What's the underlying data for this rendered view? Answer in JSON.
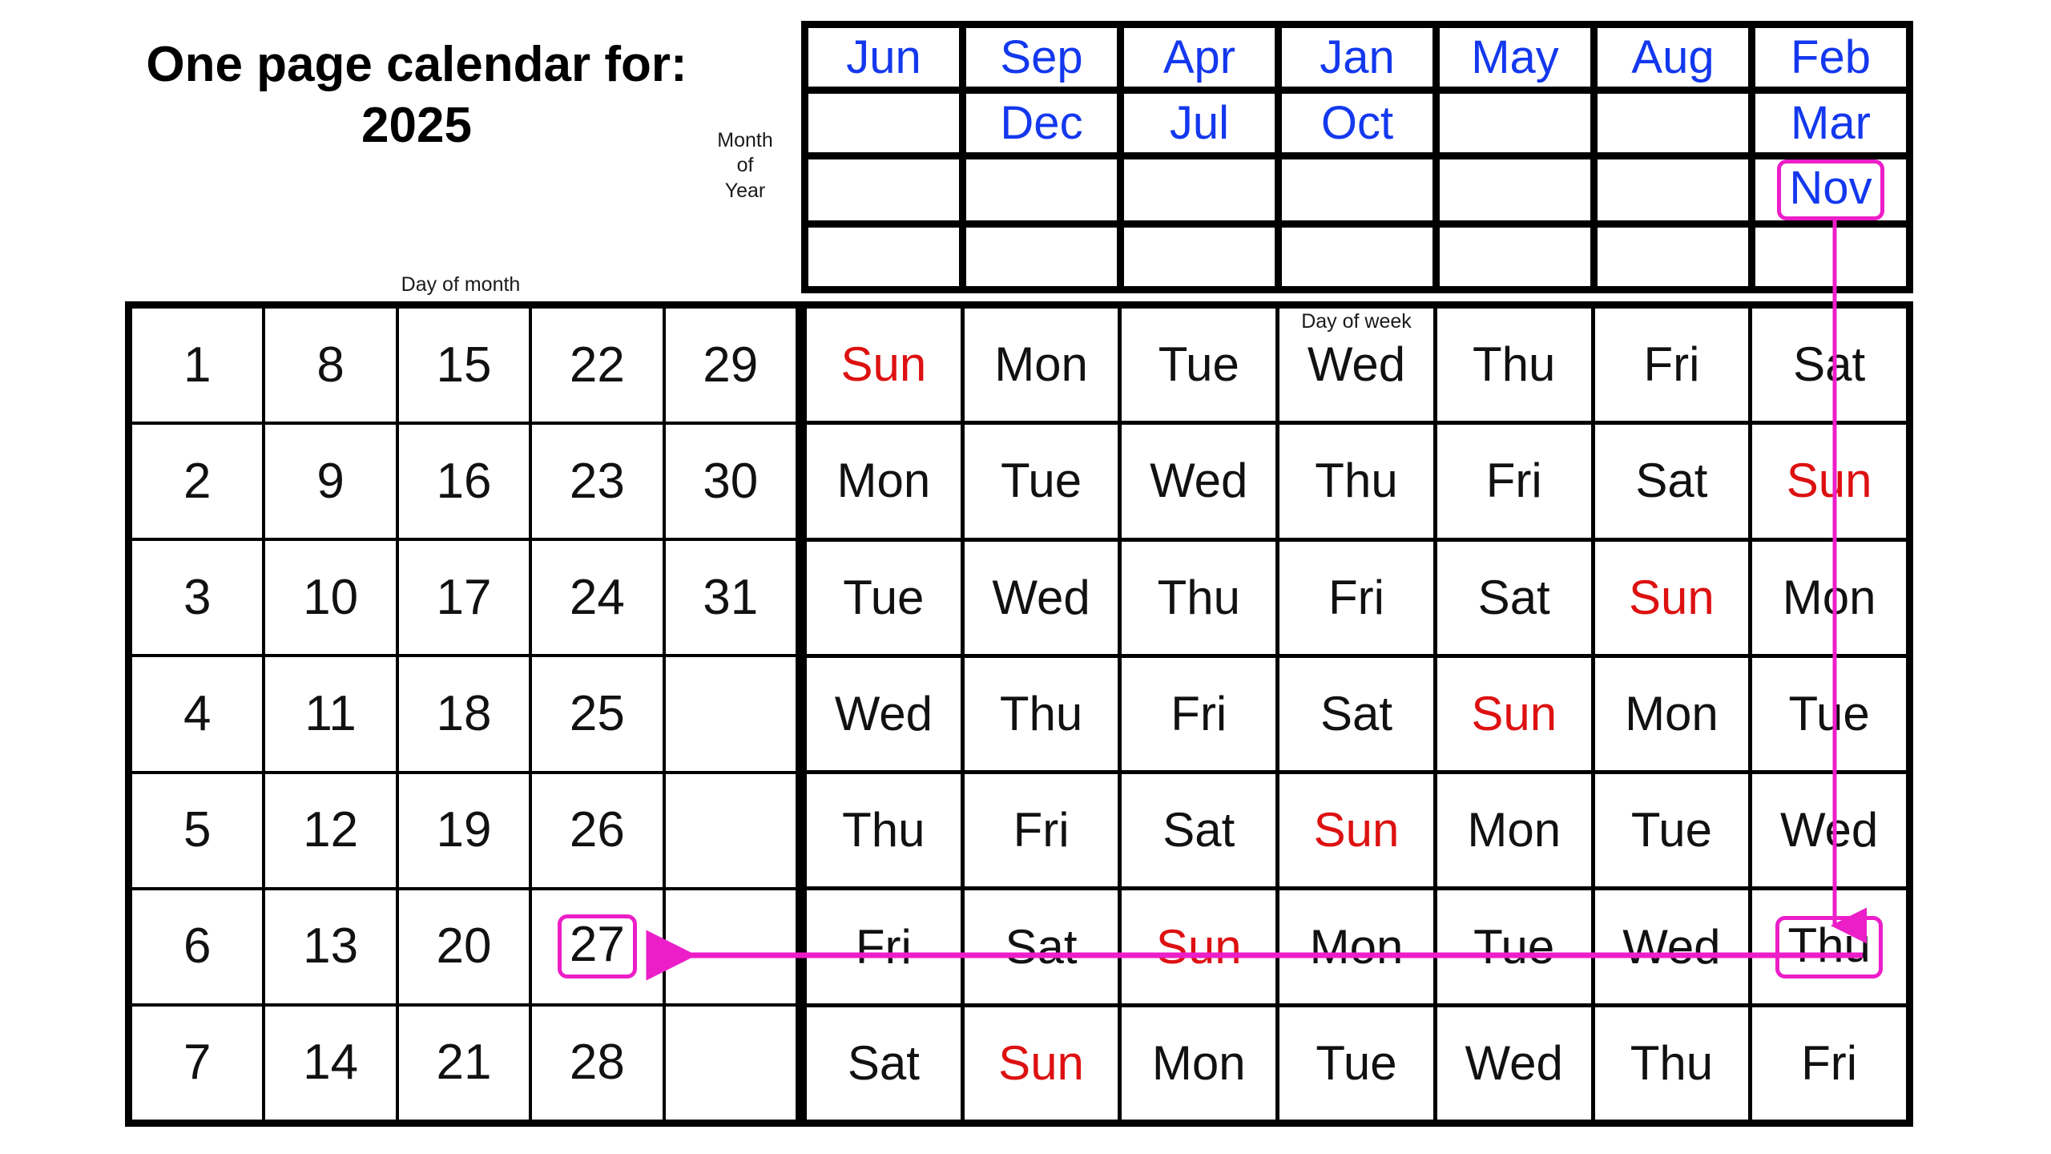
{
  "title": {
    "line1": "One page calendar for:",
    "line2": "2025"
  },
  "captions": {
    "month_of_year": "Month\nof\nYear",
    "month_of_year_lines": [
      "Month",
      "of",
      "Year"
    ],
    "day_of_month": "Day of month",
    "day_of_week": "Day of week"
  },
  "colors": {
    "month_text": "#1338ee",
    "sunday_text": "#dd1111",
    "weekday_text": "#111111",
    "highlight": "#ec1ec8",
    "grid": "#000000",
    "cell_background": "#ffffff",
    "page_background": "#ffffff"
  },
  "month_grid": {
    "columns": 7,
    "rows": 4,
    "cells": [
      [
        "Jun",
        "Sep",
        "Apr",
        "Jan",
        "May",
        "Aug",
        "Feb"
      ],
      [
        "",
        "Dec",
        "Jul",
        "Oct",
        "",
        "",
        "Mar"
      ],
      [
        "",
        "",
        "",
        "",
        "",
        "",
        "Nov"
      ],
      [
        "",
        "",
        "",
        "",
        "",
        "",
        ""
      ]
    ],
    "highlighted": {
      "row": 2,
      "col": 6,
      "value": "Nov"
    }
  },
  "day_of_month_grid": {
    "columns": 5,
    "rows": 7,
    "cells": [
      [
        "1",
        "8",
        "15",
        "22",
        "29"
      ],
      [
        "2",
        "9",
        "16",
        "23",
        "30"
      ],
      [
        "3",
        "10",
        "17",
        "24",
        "31"
      ],
      [
        "4",
        "11",
        "18",
        "25",
        ""
      ],
      [
        "5",
        "12",
        "19",
        "26",
        ""
      ],
      [
        "6",
        "13",
        "20",
        "27",
        ""
      ],
      [
        "7",
        "14",
        "21",
        "28",
        ""
      ]
    ],
    "highlighted": {
      "row": 5,
      "col": 3,
      "value": "27"
    }
  },
  "day_of_week_grid": {
    "columns": 7,
    "rows": 7,
    "cells": [
      [
        "Sun",
        "Mon",
        "Tue",
        "Wed",
        "Thu",
        "Fri",
        "Sat"
      ],
      [
        "Mon",
        "Tue",
        "Wed",
        "Thu",
        "Fri",
        "Sat",
        "Sun"
      ],
      [
        "Tue",
        "Wed",
        "Thu",
        "Fri",
        "Sat",
        "Sun",
        "Mon"
      ],
      [
        "Wed",
        "Thu",
        "Fri",
        "Sat",
        "Sun",
        "Mon",
        "Tue"
      ],
      [
        "Thu",
        "Fri",
        "Sat",
        "Sun",
        "Mon",
        "Tue",
        "Wed"
      ],
      [
        "Fri",
        "Sat",
        "Sun",
        "Mon",
        "Tue",
        "Wed",
        "Thu"
      ],
      [
        "Sat",
        "Sun",
        "Mon",
        "Tue",
        "Wed",
        "Thu",
        "Fri"
      ]
    ],
    "highlighted": {
      "row": 5,
      "col": 6,
      "value": "Thu"
    }
  },
  "annotations": {
    "vertical_arrow": {
      "from": "Nov",
      "to": "Thu"
    },
    "horizontal_arrow": {
      "from": "Thu",
      "to": "27"
    }
  }
}
